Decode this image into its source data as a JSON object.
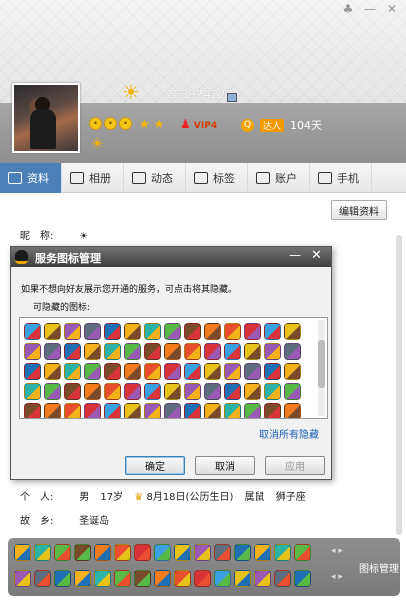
{
  "profile": {
    "qq_number": "253974227",
    "membership_days": "104天",
    "vip_label": "VIP4",
    "daren_badge": "达人"
  },
  "tabs": [
    {
      "label": "资料",
      "icon": "id-card-icon"
    },
    {
      "label": "相册",
      "icon": "photo-icon"
    },
    {
      "label": "动态",
      "icon": "feed-icon"
    },
    {
      "label": "标签",
      "icon": "tag-icon"
    },
    {
      "label": "账户",
      "icon": "wallet-icon"
    },
    {
      "label": "手机",
      "icon": "phone-icon"
    }
  ],
  "main": {
    "edit_button": "编辑资料",
    "nickname_label": "昵　称:",
    "nickname_value": "☀",
    "person_label": "个　人:",
    "gender": "男",
    "age": "17岁",
    "birthday": "8月18日(公历生日)",
    "zodiac": "属鼠",
    "constellation": "狮子座",
    "hometown_label": "故　乡:",
    "hometown_value": "圣诞岛"
  },
  "strip": {
    "label": "图标管理"
  },
  "dialog": {
    "title": "服务图标管理",
    "description": "如果不想向好友展示您开通的服务，可点击将其隐藏。",
    "hidden_icons_label": "可隐藏的图标:",
    "unhide_all_link": "取消所有隐藏",
    "ok_button": "确定",
    "cancel_button": "取消",
    "apply_button": "应用"
  },
  "colors": {
    "tab_active": "#4b7fb8",
    "link": "#1a5fb4",
    "strip_bg": "#858585"
  }
}
